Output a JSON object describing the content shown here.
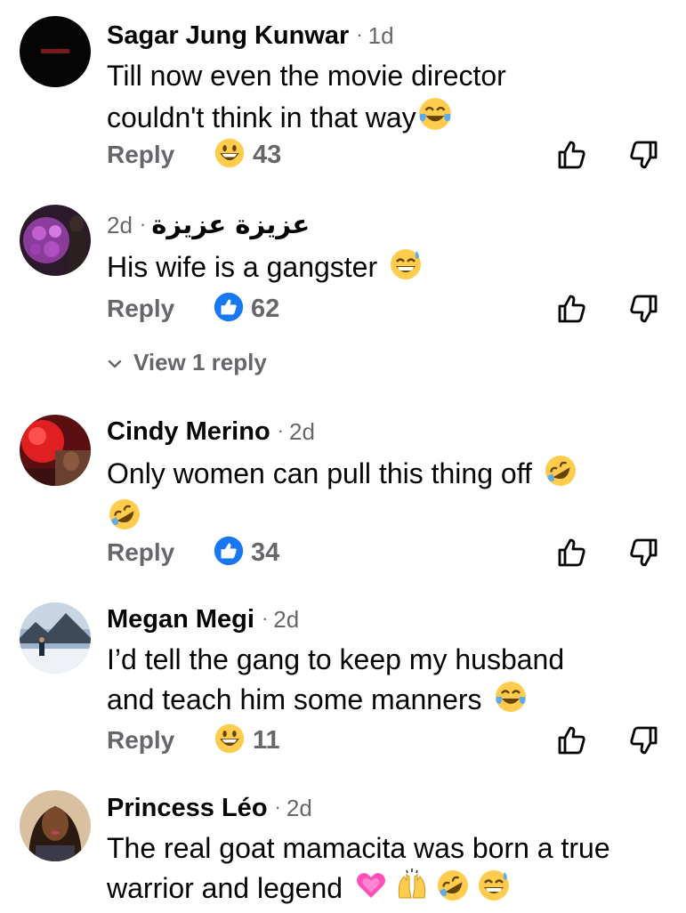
{
  "comments": [
    {
      "author": "Sagar Jung Kunwar",
      "time": "1d",
      "text_lines": [
        "Till now even the movie director",
        "couldn't think in that way"
      ],
      "text_emoji": [
        "tears-of-joy-emoji"
      ],
      "reply_label": "Reply",
      "reaction_icon": "grin-emoji",
      "reaction_count": "43"
    },
    {
      "author": "عزيزة عزيزة",
      "time": "2d",
      "text_lines": [
        "His wife is a gangster"
      ],
      "text_emoji": [
        "sweat-smile-emoji"
      ],
      "reply_label": "Reply",
      "reaction_icon": "like-icon",
      "reaction_count": "62",
      "view_replies": "View 1 reply"
    },
    {
      "author": "Cindy Merino",
      "time": "2d",
      "text_lines": [
        "Only women can pull this thing off"
      ],
      "text_emoji": [
        "rofl-emoji",
        "rofl-emoji"
      ],
      "reply_label": "Reply",
      "reaction_icon": "like-icon",
      "reaction_count": "34"
    },
    {
      "author": "Megan Megi",
      "time": "2d",
      "text_lines": [
        "I’d tell the gang to keep my husband",
        "and teach him some manners"
      ],
      "text_emoji": [
        "tears-of-joy-emoji"
      ],
      "reply_label": "Reply",
      "reaction_icon": "grin-emoji",
      "reaction_count": "11"
    },
    {
      "author": "Princess Léo",
      "time": "2d",
      "text_lines": [
        "The real goat mamacita was born a true",
        "warrior and legend"
      ],
      "text_emoji": [
        "growing-heart-emoji",
        "raising-hands-emoji",
        "rofl-emoji",
        "sweat-smile-emoji"
      ]
    }
  ],
  "colors": {
    "secondary_text": "#65676b",
    "primary_text": "#050505",
    "like_blue": "#1877f2",
    "emoji_yellow": "#ffcc4d"
  }
}
